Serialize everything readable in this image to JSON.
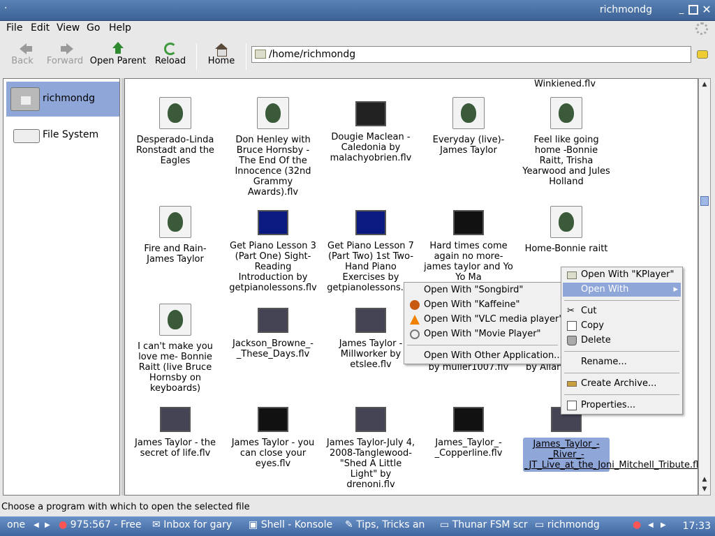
{
  "window": {
    "title": "richmondg"
  },
  "menubar": [
    "File",
    "Edit",
    "View",
    "Go",
    "Help"
  ],
  "toolbar": {
    "back": "Back",
    "forward": "Forward",
    "open_parent": "Open Parent",
    "reload": "Reload",
    "home": "Home"
  },
  "location": "/home/richmondg",
  "sidebar": [
    {
      "label": "richmondg",
      "icon": "home-folder-icon",
      "selected": true
    },
    {
      "label": "File System",
      "icon": "drive-icon",
      "selected": false
    }
  ],
  "files_top_partial": "Winkiened.flv",
  "files": [
    {
      "name": "Desperado-Linda Ronstadt and the Eagles",
      "icon": "gnome"
    },
    {
      "name": "Don Henley with Bruce Hornsby - The End Of the Innocence (32nd Grammy Awards).flv",
      "icon": "gnome"
    },
    {
      "name": "Dougie Maclean - Caledonia by malachyobrien.flv",
      "icon": "video"
    },
    {
      "name": "Everyday (live)-James Taylor",
      "icon": "gnome"
    },
    {
      "name": "Feel like going home -Bonnie Raitt, Trisha Yearwood and Jules Holland",
      "icon": "gnome"
    },
    {
      "name": "Fire and Rain-James Taylor",
      "icon": "gnome"
    },
    {
      "name": "Get Piano Lesson 3 (Part One) Sight-Reading Introduction by getpianolessons.flv",
      "icon": "video"
    },
    {
      "name": "Get Piano Lesson 7 (Part Two) 1st Two-Hand Piano Exercises by getpianolessons.flv",
      "icon": "video"
    },
    {
      "name": "Hard times come again no more-james taylor and Yo Yo Ma",
      "icon": "video"
    },
    {
      "name": "Home-Bonnie raitt",
      "icon": "gnome"
    },
    {
      "name": "I can't make you love me- Bonnie Raitt (live Bruce Hornsby on keyboards)",
      "icon": "gnome"
    },
    {
      "name": "Jackson_Browne_-_These_Days.flv",
      "icon": "video"
    },
    {
      "name": "James Taylor - Millworker by etslee.flv",
      "icon": "video"
    },
    {
      "name": "by muller1007.flv",
      "icon": "video"
    },
    {
      "name": "by Allan",
      "icon": "video"
    },
    {
      "name": "James Taylor - the secret of life.flv",
      "icon": "video"
    },
    {
      "name": "James Taylor - you can close your eyes.flv",
      "icon": "video"
    },
    {
      "name": "James Taylor-July 4, 2008-Tanglewood-\"Shed A Little Light\" by drenoni.flv",
      "icon": "video"
    },
    {
      "name": "James_Taylor_-_Copperline.flv",
      "icon": "video"
    },
    {
      "name": "James_Taylor_-_River_-_JT_Live_at_the_Joni_Mitchell_Tribute.flv",
      "icon": "video",
      "selected": true
    }
  ],
  "context_menu": [
    {
      "label": "Open With \"KPlayer\"",
      "icon": "folder-open-icon"
    },
    {
      "label": "Open With",
      "submenu": true,
      "highlighted": true
    },
    {
      "label": "Cut",
      "icon": "cut-icon"
    },
    {
      "label": "Copy",
      "icon": "copy-icon"
    },
    {
      "label": "Delete",
      "icon": "trash-icon"
    },
    {
      "label": "Rename..."
    },
    {
      "label": "Create Archive...",
      "icon": "archive-icon"
    },
    {
      "label": "Properties...",
      "icon": "properties-icon"
    }
  ],
  "submenu": [
    {
      "label": "Open With \"Songbird\""
    },
    {
      "label": "Open With \"Kaffeine\"",
      "icon": "kaffeine-icon"
    },
    {
      "label": "Open With \"VLC media player\"",
      "icon": "vlc-cone-icon"
    },
    {
      "label": "Open With \"Movie Player\"",
      "icon": "movie-player-icon"
    },
    {
      "label": "Open With Other Application..."
    }
  ],
  "status": "Choose a program with which to open the selected file",
  "taskbar": {
    "desktop": "one",
    "tasks": [
      "975:567 - Free",
      "Inbox for gary",
      "Shell - Konsole",
      "Tips, Tricks an",
      "Thunar FSM scr",
      "richmondg"
    ],
    "clock": "17:33"
  }
}
